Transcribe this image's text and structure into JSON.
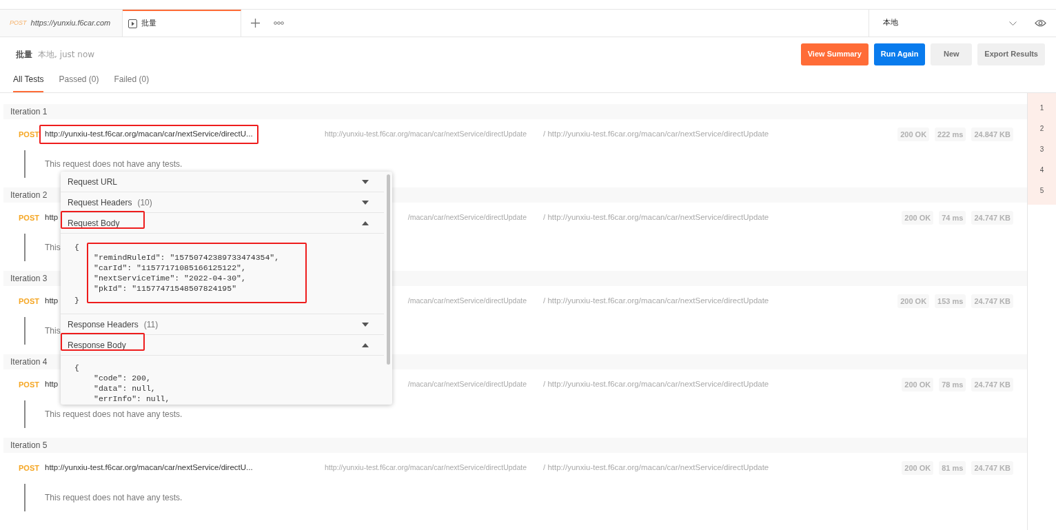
{
  "top_tabs": [
    {
      "kind": "request",
      "method": "POST",
      "label": "https://yunxiu.f6car.com",
      "selected": false
    },
    {
      "kind": "runner",
      "label": "批量",
      "selected": true
    }
  ],
  "environment": {
    "value": "本地"
  },
  "runner": {
    "title": "批量",
    "subtitle": "本地, just now",
    "buttons": [
      {
        "label": "View Summary",
        "kind": "orange"
      },
      {
        "label": "Run Again",
        "kind": "blue"
      },
      {
        "label": "New",
        "kind": "plain"
      },
      {
        "label": "Export Results",
        "kind": "plain"
      }
    ]
  },
  "filter_tabs": [
    {
      "label": "All Tests",
      "selected": true
    },
    {
      "label": "Passed (0)",
      "selected": false
    },
    {
      "label": "Failed (0)",
      "selected": false
    }
  ],
  "iterations": [
    {
      "title": "Iteration 1",
      "method": "POST",
      "url": "http://yunxiu-test.f6car.org/macan/car/nextService/directU...",
      "url_highlighted": true,
      "request_url": "http://yunxiu-test.f6car.org/macan/car/nextService/directUpdate",
      "response_url": "/ http://yunxiu-test.f6car.org/macan/car/nextService/directUpdate",
      "status": "200 OK",
      "time": "222 ms",
      "size": "24.847 KB",
      "tests_note": "This request does not have any tests."
    },
    {
      "title": "Iteration 2",
      "method": "POST",
      "url": "http",
      "url_highlighted": false,
      "request_url": "/macan/car/nextService/directUpdate",
      "response_url": "/ http://yunxiu-test.f6car.org/macan/car/nextService/directUpdate",
      "status": "200 OK",
      "time": "74 ms",
      "size": "24.747 KB",
      "tests_note": "This"
    },
    {
      "title": "Iteration 3",
      "method": "POST",
      "url": "http",
      "url_highlighted": false,
      "request_url": "/macan/car/nextService/directUpdate",
      "response_url": "/ http://yunxiu-test.f6car.org/macan/car/nextService/directUpdate",
      "status": "200 OK",
      "time": "153 ms",
      "size": "24.747 KB",
      "tests_note": "This"
    },
    {
      "title": "Iteration 4",
      "method": "POST",
      "url": "http",
      "url_highlighted": false,
      "request_url": "/macan/car/nextService/directUpdate",
      "response_url": "/ http://yunxiu-test.f6car.org/macan/car/nextService/directUpdate",
      "status": "200 OK",
      "time": "78 ms",
      "size": "24.747 KB",
      "tests_note": "This request does not have any tests."
    },
    {
      "title": "Iteration 5",
      "method": "POST",
      "url": "http://yunxiu-test.f6car.org/macan/car/nextService/directU...",
      "url_highlighted": false,
      "request_url": "http://yunxiu-test.f6car.org/macan/car/nextService/directUpdate",
      "response_url": "/ http://yunxiu-test.f6car.org/macan/car/nextService/directUpdate",
      "status": "200 OK",
      "time": "81 ms",
      "size": "24.747 KB",
      "tests_note": "This request does not have any tests."
    }
  ],
  "iteration_index": [
    "1",
    "2",
    "3",
    "4",
    "5"
  ],
  "details_popup": {
    "sections": [
      {
        "label": "Request URL",
        "expanded": false,
        "highlighted": false
      },
      {
        "label": "Request Headers",
        "count": "(10)",
        "expanded": false,
        "highlighted": false
      },
      {
        "label": "Request Body",
        "expanded": true,
        "highlighted": true,
        "body_open": "{",
        "body_lines": [
          "\"remindRuleId\": \"15750742389733474354\",",
          "\"carId\": \"11577171085166125122\",",
          "\"nextServiceTime\": \"2022-04-30\",",
          "\"pkId\": \"11577471548507824195\""
        ],
        "body_close": "}",
        "body_highlighted": true
      },
      {
        "label": "Response Headers",
        "count": "(11)",
        "expanded": false,
        "highlighted": false
      },
      {
        "label": "Response Body",
        "expanded": true,
        "highlighted": true,
        "body_open": "{",
        "body_lines": [
          "\"code\": 200,",
          "\"data\": null,",
          "\"errInfo\": null,"
        ]
      }
    ]
  }
}
